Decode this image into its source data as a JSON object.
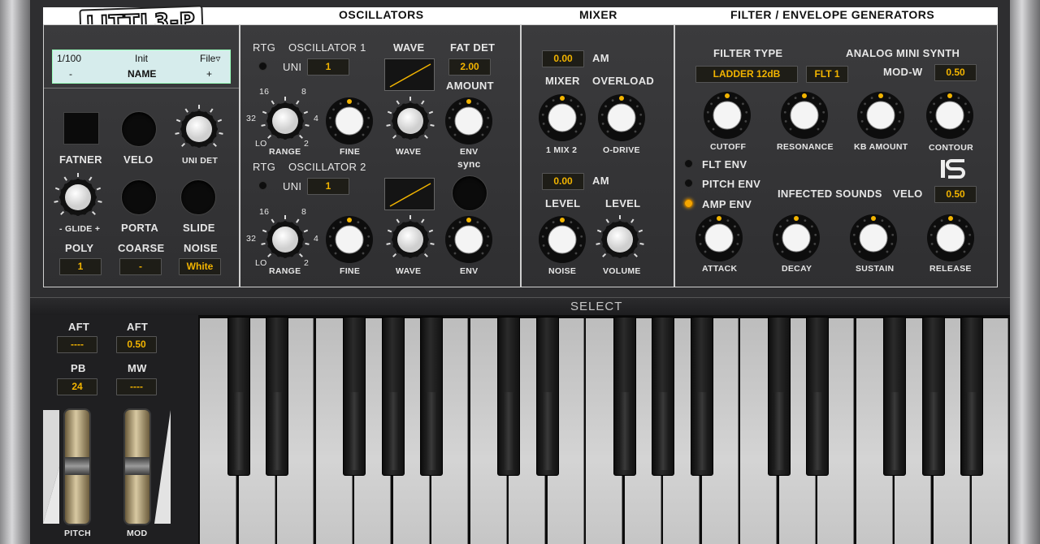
{
  "header": {
    "logo": "LITTL3-P",
    "oscillators": "OSCILLATORS",
    "mixer": "MIXER",
    "filter_env": "FILTER / ENVELOPE GENERATORS"
  },
  "preset": {
    "index": "1/100",
    "name_label": "Init",
    "file_menu": "File▿",
    "minus": "-",
    "name": "NAME",
    "plus": "+"
  },
  "left": {
    "fatner": "FATNER",
    "velo": "VELO",
    "uni_det": "UNI DET",
    "glide": "- GLIDE +",
    "porta": "PORTA",
    "slide": "SLIDE",
    "poly_label": "POLY",
    "poly_value": "1",
    "coarse_label": "COARSE",
    "coarse_value": "-",
    "noise_label": "NOISE",
    "noise_value": "White"
  },
  "osc": {
    "rtg": "RTG",
    "osc1": "OSCILLATOR 1",
    "osc2": "OSCILLATOR 2",
    "uni": "UNI",
    "uni1_value": "1",
    "uni2_value": "1",
    "wave": "WAVE",
    "fat_det": "FAT DET",
    "fat_det_value": "2.00",
    "amount": "AMOUNT",
    "range": "RANGE",
    "fine": "FINE",
    "wave_knob": "WAVE",
    "env_sync": "ENV\nsync",
    "env": "ENV",
    "env_label": "ENV",
    "sync_label": "sync",
    "scale_16": "16",
    "scale_8": "8",
    "scale_32": "32",
    "scale_4": "4",
    "scale_lo": "LO",
    "scale_2": "2"
  },
  "mixer": {
    "am1_value": "0.00",
    "am": "AM",
    "mixer": "MIXER",
    "overload": "OVERLOAD",
    "mix_knob": "1 MIX 2",
    "odrive": "O-DRIVE",
    "am2_value": "0.00",
    "level": "LEVEL",
    "noise": "NOISE",
    "volume": "VOLUME"
  },
  "filter": {
    "filter_type": "FILTER TYPE",
    "type_value": "LADDER   12dB",
    "flt_value": "FLT 1",
    "synth_name": "ANALOG MINI SYNTH",
    "mod_w": "MOD-W",
    "mod_w_value": "0.50",
    "cutoff": "CUTOFF",
    "resonance": "RESONANCE",
    "kb_amount": "KB AMOUNT",
    "contour": "CONTOUR",
    "flt_env": "FLT ENV",
    "pitch_env": "PITCH ENV",
    "amp_env": "AMP ENV",
    "brand": "INFECTED SOUNDS",
    "velo": "VELO",
    "velo_value": "0.50",
    "attack": "ATTACK",
    "decay": "DECAY",
    "sustain": "SUSTAIN",
    "release": "RELEASE"
  },
  "select": "SELECT",
  "wheels": {
    "aft1_label": "AFT",
    "aft1_value": "----",
    "aft2_label": "AFT",
    "aft2_value": "0.50",
    "pb_label": "PB",
    "pb_value": "24",
    "mw_label": "MW",
    "mw_value": "----",
    "pitch": "PITCH",
    "mod": "MOD"
  },
  "colors": {
    "accent": "#f2b400",
    "panel": "#333335",
    "header": "#ffffff"
  }
}
